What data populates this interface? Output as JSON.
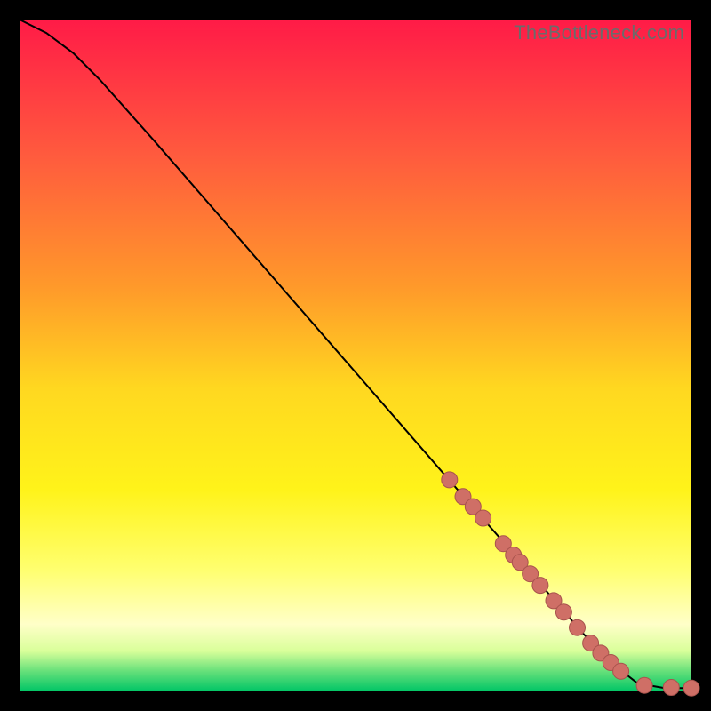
{
  "watermark": "TheBottleneck.com",
  "colors": {
    "bg": "#000000",
    "curve": "#000000",
    "marker_fill": "#cf6f66",
    "marker_stroke": "#a8534d"
  },
  "chart_data": {
    "type": "line",
    "title": "",
    "xlabel": "",
    "ylabel": "",
    "xlim": [
      0,
      100
    ],
    "ylim": [
      0,
      100
    ],
    "series": [
      {
        "name": "bottleneck-curve",
        "x": [
          0,
          4,
          8,
          12,
          20,
          30,
          40,
          50,
          60,
          68,
          76,
          84,
          88,
          92,
          96,
          100
        ],
        "y": [
          100,
          98,
          95,
          91,
          82,
          70.5,
          59,
          47.5,
          36,
          26.8,
          17.7,
          8.5,
          4.3,
          1.2,
          0.5,
          0.5
        ]
      }
    ],
    "markers": {
      "name": "highlighted-points",
      "x": [
        64,
        66,
        67.5,
        69,
        72,
        73.5,
        74.5,
        76,
        77.5,
        79.5,
        81,
        83,
        85,
        86.5,
        88,
        89.5,
        93,
        97,
        100
      ],
      "y": [
        31.5,
        29,
        27.5,
        25.8,
        22,
        20.3,
        19.2,
        17.5,
        15.8,
        13.5,
        11.8,
        9.5,
        7.2,
        5.7,
        4.3,
        3.0,
        0.9,
        0.6,
        0.5
      ]
    }
  }
}
